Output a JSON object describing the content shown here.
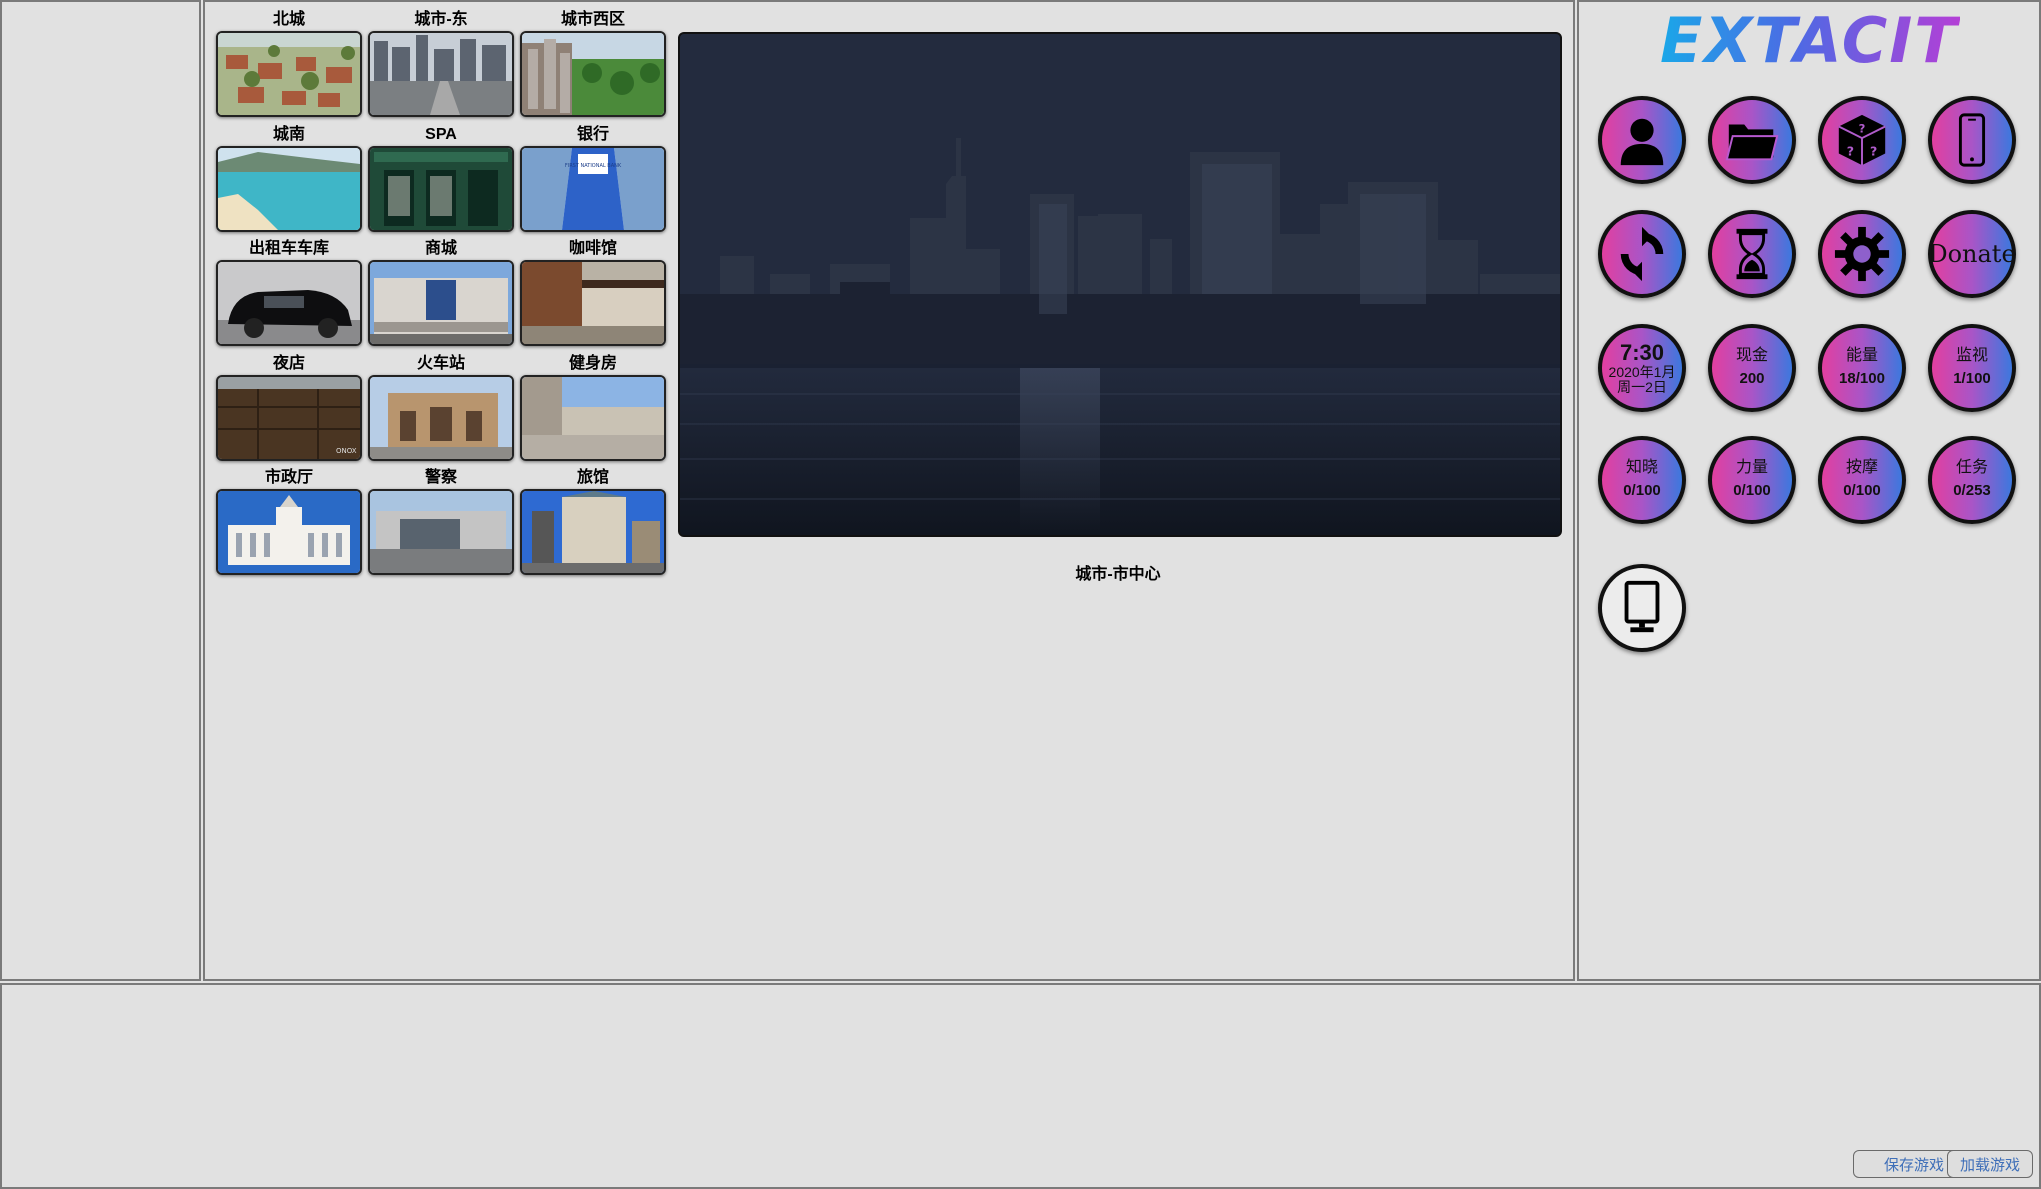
{
  "locations": [
    {
      "label": "北城",
      "scene": "suburb"
    },
    {
      "label": "城市-东",
      "scene": "downtown"
    },
    {
      "label": "城市西区",
      "scene": "park"
    },
    {
      "label": "城南",
      "scene": "beach"
    },
    {
      "label": "SPA",
      "scene": "spa"
    },
    {
      "label": "银行",
      "scene": "bank"
    },
    {
      "label": "出租车车库",
      "scene": "taxi"
    },
    {
      "label": "商城",
      "scene": "mall"
    },
    {
      "label": "咖啡馆",
      "scene": "cafe"
    },
    {
      "label": "夜店",
      "scene": "club"
    },
    {
      "label": "火车站",
      "scene": "station"
    },
    {
      "label": "健身房",
      "scene": "gym"
    },
    {
      "label": "市政厅",
      "scene": "cityhall"
    },
    {
      "label": "警察",
      "scene": "police"
    },
    {
      "label": "旅馆",
      "scene": "hotel"
    }
  ],
  "bank_sign": "FIRST NATIONAL BANK",
  "club_sign": "ONOX",
  "current_location": "城市-市中心",
  "logo": "EXTACITY",
  "menu_icons": [
    "person-icon",
    "folder-icon",
    "dice-icon",
    "phone-icon",
    "refresh-icon",
    "hourglass-icon",
    "gear-icon"
  ],
  "donate_label": "Donate",
  "clock": {
    "time": "7:30",
    "date": "2020年1月",
    "weekday": "周一2日"
  },
  "stats": {
    "money": {
      "name": "现金",
      "value": "200"
    },
    "energy": {
      "name": "能量",
      "value": "18/100"
    },
    "surveillance": {
      "name": "监视",
      "value": "1/100"
    },
    "knowledge": {
      "name": "知晓",
      "value": "0/100"
    },
    "strength": {
      "name": "力量",
      "value": "0/100"
    },
    "massage": {
      "name": "按摩",
      "value": "0/100"
    },
    "quests": {
      "name": "任务",
      "value": "0/253"
    }
  },
  "gallery_icon": "billboard-icon",
  "buttons": {
    "save": "保存游戏",
    "load": "加载游戏"
  },
  "colors": {
    "accent_pink": "#e23fa0",
    "accent_blue": "#3c78de",
    "panel_bg": "#e1e1e1"
  }
}
